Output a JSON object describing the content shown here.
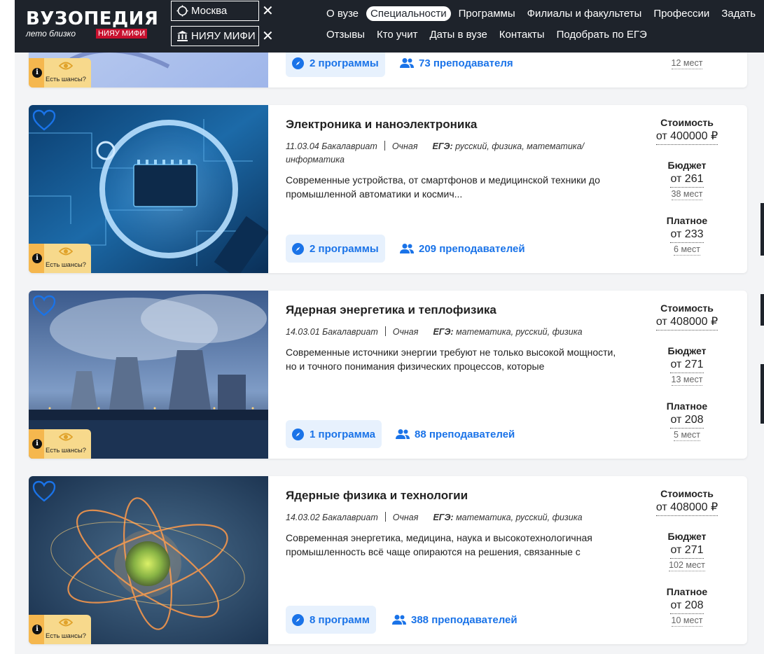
{
  "header": {
    "logo_title": "ВУЗОПЕДИЯ",
    "logo_sub": "лето близко",
    "logo_badge": "НИЯУ МИФИ",
    "city": "Москва",
    "university": "НИЯУ МИФИ",
    "clear_symbol": "✕",
    "nav_row1": [
      "О вузе",
      "Специальности",
      "Программы",
      "Филиалы и факультеты",
      "Профессии",
      "Задать"
    ],
    "nav_row2": [
      "Отзывы",
      "Кто учит",
      "Даты в вузе",
      "Контакты",
      "Подобрать по ЕГЭ"
    ],
    "active_nav": "Специальности"
  },
  "labels": {
    "cost": "Стоимость",
    "budget": "Бюджет",
    "paid": "Платное",
    "chance": "Есть шансы?",
    "info": "i",
    "ege": "ЕГЭ:"
  },
  "top_partial_card": {
    "programs": "2 программы",
    "teachers": "73 преподавателя",
    "paid_places": "12 мест"
  },
  "cards": [
    {
      "title": "Электроника и наноэлектроника",
      "code": "11.03.04 Бакалавриат",
      "form": "Очная",
      "ege": "русский, физика, математика/информатика",
      "description": "Современные устройства, от смартфонов и медицинской техники до промышленной автоматики и космич...",
      "programs": "2 программы",
      "teachers": "209 преподавателей",
      "cost": "от 400000 ₽",
      "budget": "от 261",
      "budget_places": "38 мест",
      "paid": "от 233",
      "paid_places": "6 мест"
    },
    {
      "title": "Ядерная энергетика и теплофизика",
      "code": "14.03.01 Бакалавриат",
      "form": "Очная",
      "ege": "математика, русский, физика",
      "description": "Современные источники энергии требуют не только высокой мощности, но и точного понимания физических процессов, которые",
      "programs": "1 программа",
      "teachers": "88 преподавателей",
      "cost": "от 408000 ₽",
      "budget": "от 271",
      "budget_places": "13 мест",
      "paid": "от 208",
      "paid_places": "5 мест"
    },
    {
      "title": "Ядерные физика и технологии",
      "code": "14.03.02 Бакалавриат",
      "form": "Очная",
      "ege": "математика, русский, физика",
      "description": "Современная энергетика, медицина, наука и высокотехнологичная промышленность всё чаще опираются на решения, связанные с",
      "programs": "8 программ",
      "teachers": "388 преподавателей",
      "cost": "от 408000 ₽",
      "budget": "от 271",
      "budget_places": "102 мест",
      "paid": "от 208",
      "paid_places": "10 мест"
    }
  ],
  "colors": {
    "header_bg": "#1e232b",
    "accent_blue": "#1a73e8",
    "pill_bg": "#e7f1fd",
    "badge_red": "#c8102e",
    "chance_bg": "#f7d98c"
  }
}
